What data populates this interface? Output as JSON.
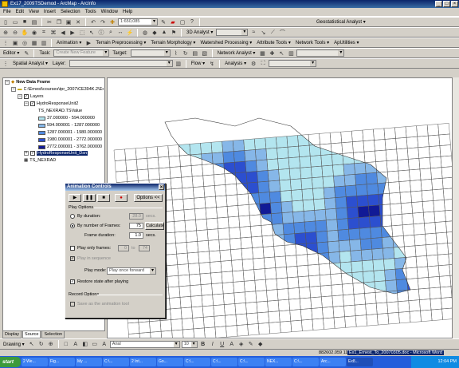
{
  "window": {
    "title": "Ex17_2009TSDemod - ArcMap - ArcInfo"
  },
  "menu": [
    "File",
    "Edit",
    "View",
    "Insert",
    "Selection",
    "Tools",
    "Window",
    "Help"
  ],
  "standard_toolbar": {
    "scale": "1:650,085",
    "geostat_label": "Geostatistical Analyst ▾"
  },
  "toolbar2": {
    "analysis_3d": "3D Analyst ▾"
  },
  "toolbar3": {
    "animation": "Animation ▾",
    "terrain_pre": "Terrain Preprocessing ▾",
    "terrain_morph": "Terrain Morphology ▾",
    "watershed": "Watershed Processing ▾",
    "attribute": "Attribute Tools ▾",
    "network": "Network Tools ▾",
    "apuntilities": "ApUtilities ▾"
  },
  "toolbar4": {
    "editor": "Editor ▾",
    "task_label": "Task:",
    "task_value": "Create New Feature",
    "target_label": "Target:",
    "network_analyst": "Network Analyst ▾"
  },
  "toolbar5": {
    "spatial_analyst": "Spatial Analyst ▾",
    "layer_label": "Layer:",
    "flow": "Flow ▾",
    "analysis": "Analysis ▾"
  },
  "toc": {
    "data_frame": "New Data Frame",
    "path": "C:\\Ernest\\courses\\tpr_2007\\CE394K.2\\Ex8\\",
    "layers": "Layers",
    "raster_layer": "HydroResponseUnit2",
    "raster_field": "TS_NEXRAD.TSValue",
    "legend": [
      {
        "label": "37.000000 - 594.000000",
        "color": "#b3e5ef"
      },
      {
        "label": "594.000001 - 1287.000000",
        "color": "#86b7e8"
      },
      {
        "label": "1287.000001 - 1980.000000",
        "color": "#4f8ae0"
      },
      {
        "label": "1980.000001 - 2772.000000",
        "color": "#2c4fcf"
      },
      {
        "label": "2772.000001 - 3762.000000",
        "color": "#111a96"
      }
    ],
    "selected_layer": "HydroResponseUnit_Dsn",
    "table": "TS_NEXRAD",
    "tabs": [
      "Display",
      "Source",
      "Selection"
    ]
  },
  "dialog": {
    "title": "Animation Controls",
    "options_button": "Options <<",
    "play_options": "Play Options",
    "by_duration": "By duration:",
    "duration_value": "28.0",
    "secs": "secs.",
    "by_frames": "By number of Frames:",
    "frames_value": "75",
    "calculate": "Calculate",
    "frame_duration": "Frame duration:",
    "frame_duration_value": "1.0",
    "play_only": "Play only frames:",
    "to": "to",
    "play_only_from": "0",
    "play_only_to": "74",
    "loop": "Play in sequence",
    "play_mode_label": "Play mode:",
    "play_mode_value": "Play once forward",
    "restore": "Restore state after playing",
    "record_options": "Record Options",
    "record_check": "Save as the animation tool"
  },
  "draw_toolbar": {
    "drawing": "Drawing ▾",
    "font": "Arial",
    "size": "10",
    "bold": "B",
    "italic": "I",
    "underline": "U"
  },
  "status": {
    "coords": "882602.059  11640015.2 Feet"
  },
  "taskbar": {
    "start": "start",
    "tasks": [
      "2 We...",
      "Fig...",
      "My ...",
      "C:\\...",
      "2 Int...",
      "Go...",
      "C:\\...",
      "C:\\...",
      "C:\\...",
      "NEX...",
      "C:\\...",
      "Arc...",
      "Ex8..."
    ],
    "preview": "Ex1_Ernest_To_20070305.doc - Microsoft Word",
    "time": "12:04 PM"
  },
  "colors": {
    "class1": "#b3e5ef",
    "class2": "#86b7e8",
    "class3": "#4f8ae0",
    "class4": "#2c4fcf",
    "class5": "#111a96",
    "title_bar": "#0a246a",
    "taskbar": "#245edb"
  }
}
